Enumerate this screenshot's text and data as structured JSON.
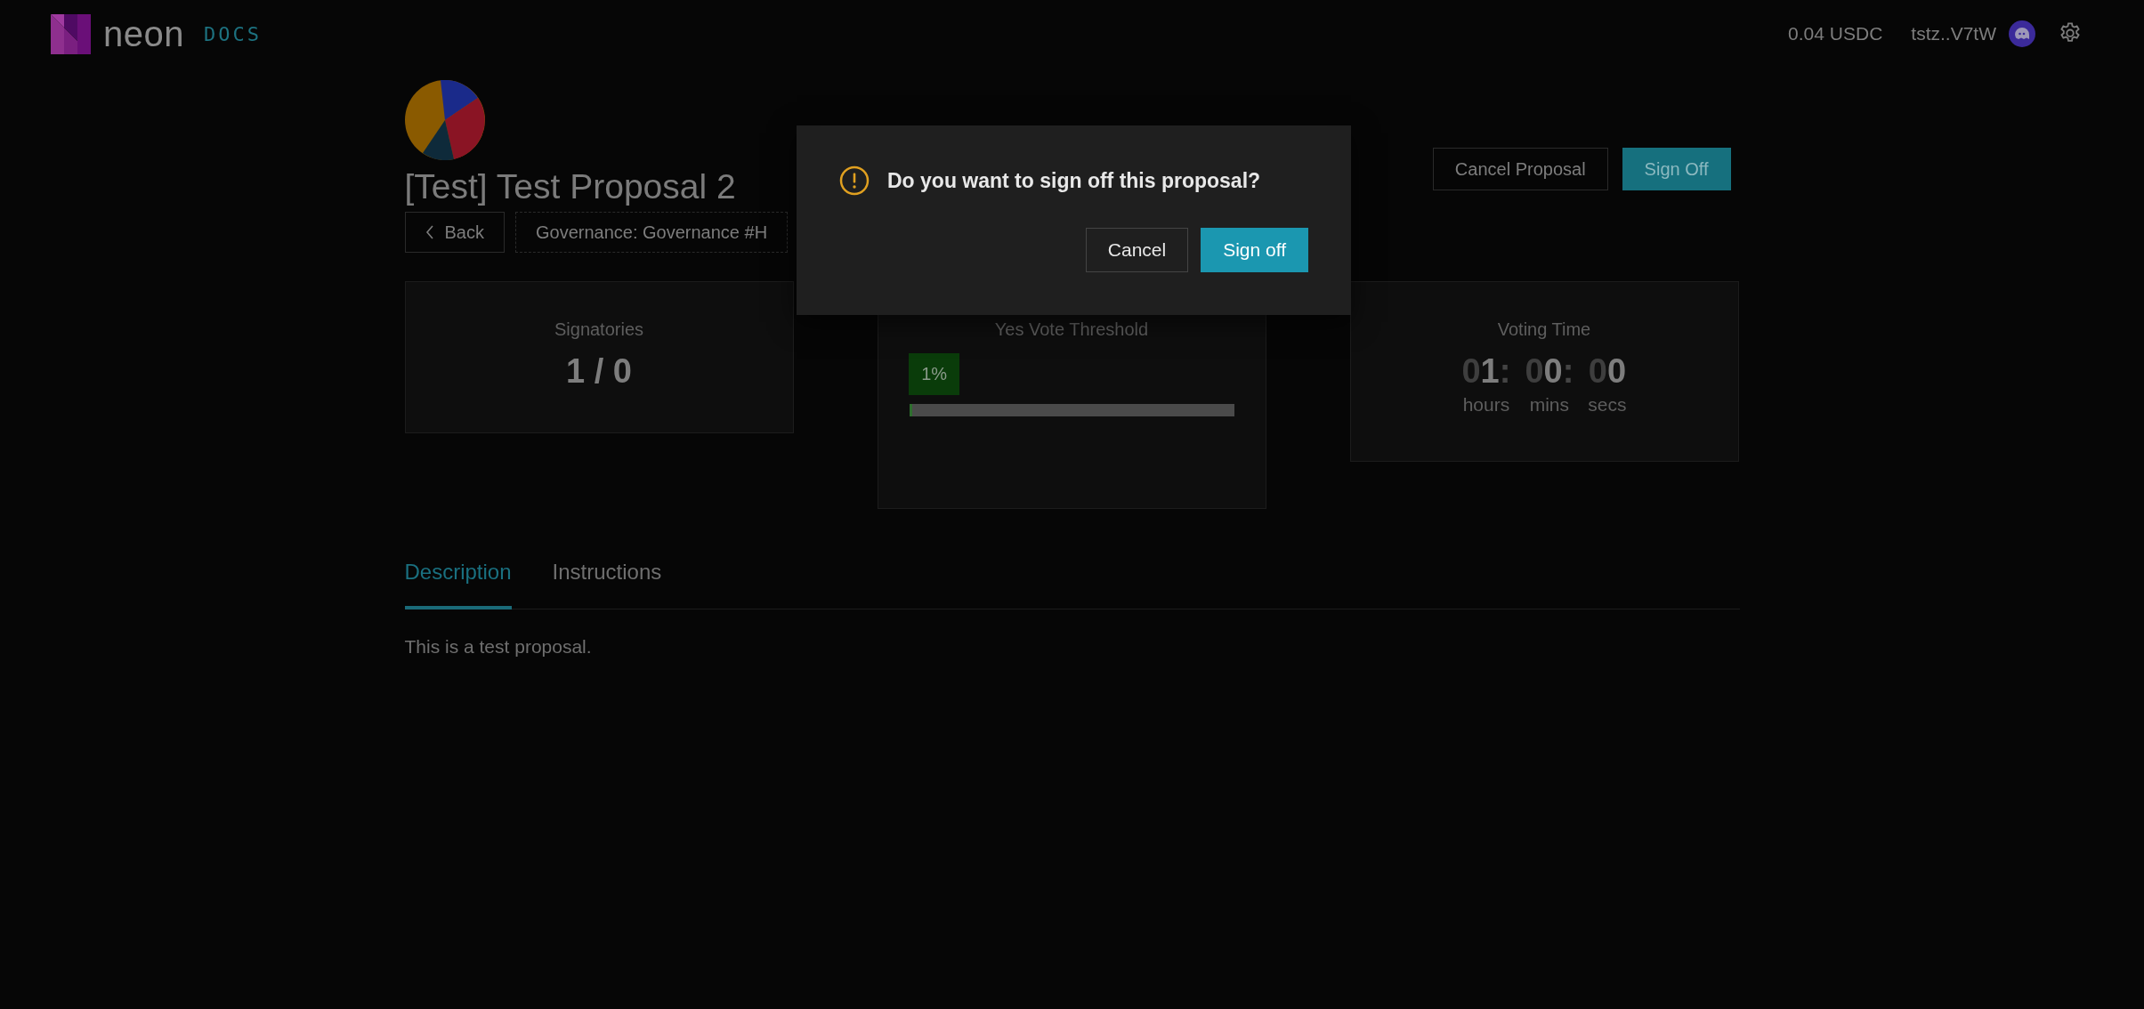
{
  "header": {
    "logo_text": "neon",
    "docs_link": "DOCS",
    "balance": "0.04 USDC",
    "wallet": "tstz..V7tW"
  },
  "proposal": {
    "title": "[Test] Test Proposal 2",
    "back_label": "Back",
    "breadcrumb": "Governance: Governance #H",
    "actions": [
      {
        "label": "Cancel Proposal",
        "kind": "secondary"
      },
      {
        "label": "Sign Off",
        "kind": "primary"
      }
    ]
  },
  "stats": {
    "signatories": {
      "label": "Signatories",
      "value": "1 / 0"
    },
    "threshold": {
      "label": "Yes Vote Threshold",
      "badge": "1%",
      "level": 0.01
    },
    "voting_time": {
      "label": "Voting Time",
      "units": [
        {
          "leading": "0",
          "value": "1",
          "separator": ":",
          "label": "hours"
        },
        {
          "leading": "0",
          "value": "0",
          "separator": ":",
          "label": "mins"
        },
        {
          "leading": "0",
          "value": "0",
          "label": "secs"
        }
      ]
    }
  },
  "tabs": [
    {
      "label": "Description",
      "selected": true
    },
    {
      "label": "Instructions",
      "selected": false
    }
  ],
  "description": "This is a test proposal.",
  "modal": {
    "message": "Do you want to sign off this proposal?",
    "buttons": [
      {
        "label": "Cancel",
        "kind": "secondary"
      },
      {
        "label": "Sign off",
        "kind": "primary"
      }
    ]
  }
}
